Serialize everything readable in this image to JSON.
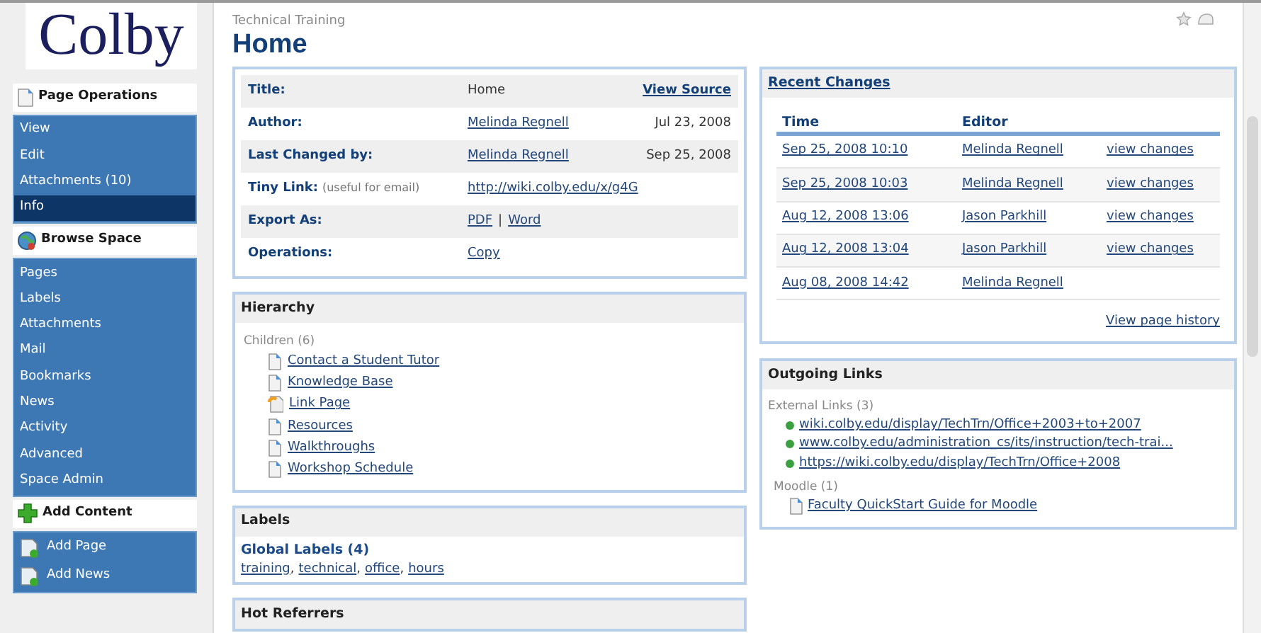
{
  "logo": {
    "text": "Colby"
  },
  "sidebar": {
    "sections": [
      {
        "title": "Page Operations",
        "items": [
          {
            "label": "View",
            "selected": false
          },
          {
            "label": "Edit",
            "selected": false
          },
          {
            "label": "Attachments (10)",
            "selected": false
          },
          {
            "label": "Info",
            "selected": true
          }
        ]
      },
      {
        "title": "Browse Space",
        "items": [
          {
            "label": "Pages",
            "selected": false
          },
          {
            "label": "Labels",
            "selected": false
          },
          {
            "label": "Attachments",
            "selected": false
          },
          {
            "label": "Mail",
            "selected": false
          },
          {
            "label": "Bookmarks",
            "selected": false
          },
          {
            "label": "News",
            "selected": false
          },
          {
            "label": "Activity",
            "selected": false
          },
          {
            "label": "Advanced",
            "selected": false
          },
          {
            "label": "Space Admin",
            "selected": false
          }
        ]
      },
      {
        "title": "Add Content",
        "items": [
          {
            "label": "Add Page",
            "selected": false
          },
          {
            "label": "Add News",
            "selected": false
          }
        ]
      }
    ]
  },
  "breadcrumb": "Technical Training",
  "title": "Home",
  "info": {
    "rows": [
      {
        "label": "Title:",
        "values": [
          {
            "text": "Home",
            "kind": "text"
          }
        ],
        "aside": {
          "text": "View Source",
          "kind": "link"
        }
      },
      {
        "label": "Author:",
        "values": [
          {
            "text": "Melinda Regnell",
            "kind": "link"
          }
        ],
        "aside": {
          "text": "Jul 23, 2008",
          "kind": "text"
        }
      },
      {
        "label": "Last Changed by:",
        "values": [
          {
            "text": "Melinda Regnell",
            "kind": "link"
          }
        ],
        "aside": {
          "text": "Sep 25, 2008",
          "kind": "text"
        }
      },
      {
        "label": "Tiny Link:",
        "note": "(useful for email)",
        "values": [
          {
            "text": "http://wiki.colby.edu/x/g4G",
            "kind": "link"
          }
        ]
      },
      {
        "label": "Export As:",
        "values": [
          {
            "text": "PDF",
            "kind": "link"
          },
          {
            "text": "|",
            "kind": "text"
          },
          {
            "text": "Word",
            "kind": "link"
          }
        ]
      },
      {
        "label": "Operations:",
        "values": [
          {
            "text": "Copy",
            "kind": "link"
          }
        ]
      }
    ]
  },
  "hierarchy": {
    "title": "Hierarchy",
    "group": "Children (6)",
    "items": [
      {
        "label": "Contact a Student Tutor",
        "kind": "page"
      },
      {
        "label": "Knowledge Base",
        "kind": "page"
      },
      {
        "label": "Link Page",
        "kind": "link"
      },
      {
        "label": "Resources",
        "kind": "page"
      },
      {
        "label": "Walkthroughs",
        "kind": "page"
      },
      {
        "label": "Workshop Schedule",
        "kind": "page"
      }
    ]
  },
  "labels": {
    "title": "Labels",
    "group": "Global Labels (4)",
    "separator": ",",
    "labels": [
      "training",
      "technical",
      "office",
      "hours"
    ]
  },
  "hot_referrers": {
    "title": "Hot Referrers"
  },
  "recent_changes": {
    "title": "Recent Changes",
    "columns": [
      "Time",
      "Editor"
    ],
    "rows": [
      {
        "time": "Sep 25, 2008 10:10",
        "editor": "Melinda Regnell",
        "action": "view changes"
      },
      {
        "time": "Sep 25, 2008 10:03",
        "editor": "Melinda Regnell",
        "action": "view changes"
      },
      {
        "time": "Aug 12, 2008 13:06",
        "editor": "Jason Parkhill",
        "action": "view changes"
      },
      {
        "time": "Aug 12, 2008 13:04",
        "editor": "Jason Parkhill",
        "action": "view changes"
      },
      {
        "time": "Aug 08, 2008 14:42",
        "editor": "Melinda Regnell"
      }
    ],
    "footer": "View page history"
  },
  "outgoing_links": {
    "title": "Outgoing Links",
    "groups": [
      {
        "title": "External Links (3)",
        "kind": "external",
        "links": [
          "wiki.colby.edu/display/TechTrn/Office+2003+to+2007",
          "www.colby.edu/administration_cs/its/instruction/tech-trai...",
          "https://wiki.colby.edu/display/TechTrn/Office+2008"
        ]
      },
      {
        "title": "Moodle (1)",
        "kind": "page",
        "links": [
          "Faculty QuickStart Guide for Moodle"
        ]
      }
    ]
  }
}
